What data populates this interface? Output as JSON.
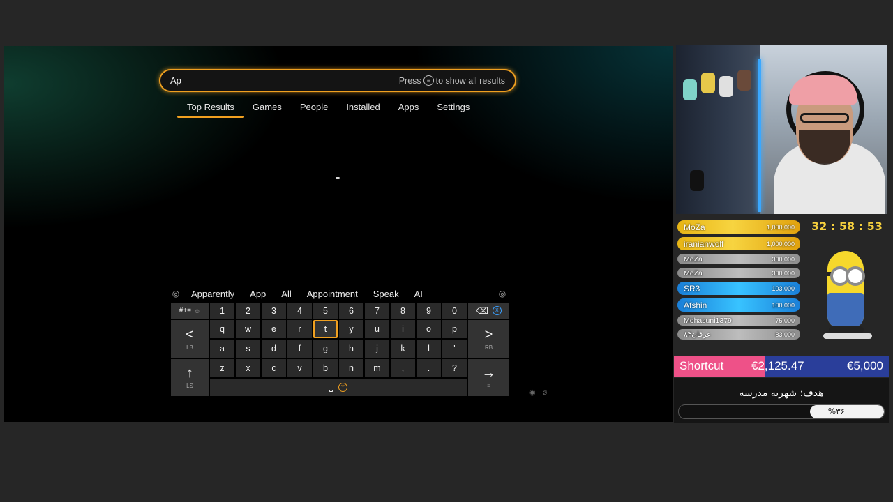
{
  "search": {
    "query": "Ap",
    "hint_prefix": "Press",
    "hint_suffix": "to show all results"
  },
  "tabs": [
    {
      "label": "Top Results",
      "active": true
    },
    {
      "label": "Games"
    },
    {
      "label": "People"
    },
    {
      "label": "Installed"
    },
    {
      "label": "Apps"
    },
    {
      "label": "Settings"
    }
  ],
  "suggestions": [
    "Apparently",
    "App",
    "All",
    "Appointment",
    "Speak",
    "AI"
  ],
  "keyboard": {
    "symbols_label": "#+=",
    "row1": [
      "1",
      "2",
      "3",
      "4",
      "5",
      "6",
      "7",
      "8",
      "9",
      "0"
    ],
    "row2": [
      "q",
      "w",
      "e",
      "r",
      "t",
      "y",
      "u",
      "i",
      "o",
      "p"
    ],
    "row3": [
      "a",
      "s",
      "d",
      "f",
      "g",
      "h",
      "j",
      "k",
      "l",
      "'"
    ],
    "row4": [
      "z",
      "x",
      "c",
      "v",
      "b",
      "n",
      "m",
      ",",
      ".",
      "?"
    ],
    "focused_key": "t",
    "left_label": "<",
    "right_label": ">",
    "shift_label": "↑",
    "enter_label": "→",
    "space_label": "⎵",
    "left_bumper": "LB",
    "right_bumper": "RB",
    "backspace_label": "⌫",
    "backspace_button": "X",
    "space_button": "Y",
    "shift_button": "LS",
    "enter_button": "≡"
  },
  "stream": {
    "timer": "32 : 58 : 53",
    "donors": [
      {
        "name": "MoZa",
        "amount": "1,000,000",
        "tier": "gold",
        "size": "big"
      },
      {
        "name": "iranianwolf",
        "amount": "1,000,000",
        "tier": "gold",
        "size": "big"
      },
      {
        "name": "MoZa",
        "amount": "300,000",
        "tier": "gray",
        "size": "small"
      },
      {
        "name": "MoZa",
        "amount": "300,000",
        "tier": "gray",
        "size": "small"
      },
      {
        "name": "SR3",
        "amount": "103,000",
        "tier": "blue",
        "size": "big"
      },
      {
        "name": "Afshin",
        "amount": "100,000",
        "tier": "blue",
        "size": "big"
      },
      {
        "name": "Mohasuni1379",
        "amount": "75,000",
        "tier": "gray",
        "size": "small"
      },
      {
        "name": "عرفان۸۳",
        "amount": "83,000",
        "tier": "gray",
        "size": "small"
      }
    ],
    "goal": {
      "name": "Shortcut",
      "current": "€2,125.47",
      "target": "€5,000",
      "progress": 0.425
    },
    "school_goal": {
      "title": "هدف: شهریه مدرسه",
      "percent_label": "%۳۶",
      "progress": 0.36
    }
  },
  "colors": {
    "accent": "#f0a020",
    "goal_fill": "#ee5188",
    "goal_bg": "#2a3e9a",
    "timer": "#f5cf3d"
  }
}
